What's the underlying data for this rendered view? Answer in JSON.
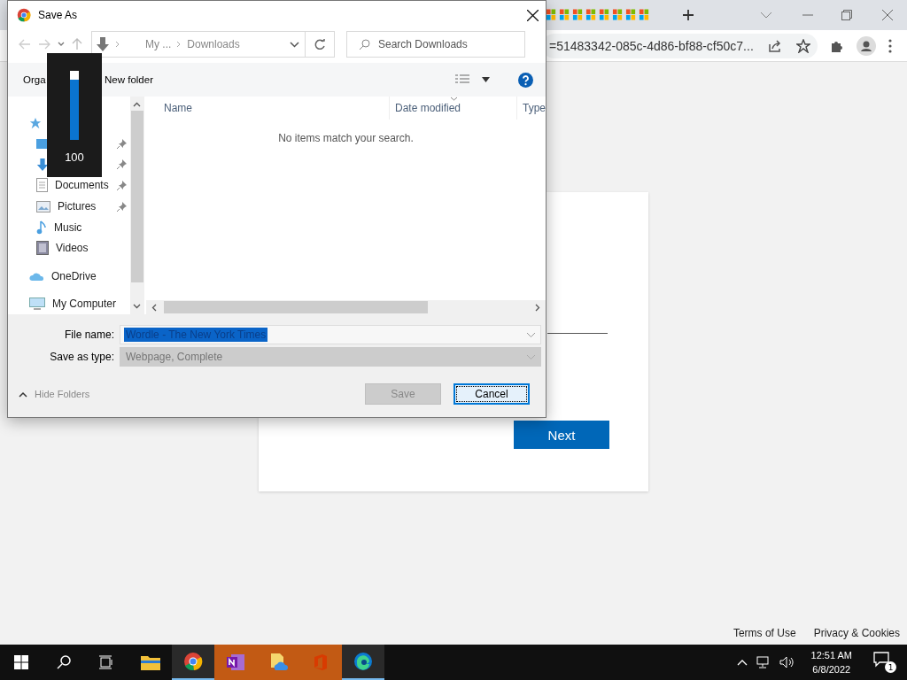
{
  "browser": {
    "address": "=51483342-085c-4d86-bf88-cf50c7..."
  },
  "page": {
    "next_button": "Next",
    "footer_links": [
      "Terms of Use",
      "Privacy & Cookies"
    ]
  },
  "dialog": {
    "title": "Save As",
    "breadcrumb": [
      "My ...",
      "Downloads"
    ],
    "search": {
      "placeholder": "Search Downloads"
    },
    "toolbar": {
      "organize": "Orga",
      "new_folder": "New folder"
    },
    "sidebar": {
      "items": [
        {
          "kind": "quick-access"
        },
        {
          "kind": "desktop",
          "pinned": true
        },
        {
          "kind": "downloads",
          "pinned": true
        },
        {
          "kind": "documents",
          "label": "Documents",
          "pinned": true
        },
        {
          "kind": "pictures",
          "label": "Pictures",
          "pinned": true
        },
        {
          "kind": "music",
          "label": "Music",
          "pinned": false
        },
        {
          "kind": "videos",
          "label": "Videos",
          "pinned": false
        },
        {
          "kind": "cloud",
          "label": "OneDrive",
          "pinned": false
        },
        {
          "kind": "computer",
          "label": "My Computer",
          "pinned": false
        }
      ]
    },
    "columns": [
      {
        "label": "Name",
        "sorted": false
      },
      {
        "label": "Date modified",
        "sorted": true
      },
      {
        "label": "Type",
        "sorted": false
      }
    ],
    "empty_message": "No items match your search.",
    "file_name": {
      "label": "File name:",
      "value": "Wordle - The New York Times",
      "selected": true
    },
    "save_type": {
      "label": "Save as type:",
      "value": "Webpage, Complete",
      "disabled": true
    },
    "hide_folders": "Hide Folders",
    "buttons": [
      {
        "label": "Save",
        "disabled": true,
        "focused": false
      },
      {
        "label": "Cancel",
        "disabled": false,
        "focused": true
      }
    ]
  },
  "volume": {
    "level": 1,
    "reading": "100"
  },
  "taskbar": {
    "apps": [
      {
        "kind": "explorer",
        "running": false,
        "flashing": false
      },
      {
        "kind": "chrome",
        "running": true,
        "flashing": false
      },
      {
        "kind": "onenote",
        "running": false,
        "flashing": true
      },
      {
        "kind": "files",
        "running": false,
        "flashing": true
      },
      {
        "kind": "office",
        "running": false,
        "flashing": true
      },
      {
        "kind": "edge",
        "running": true,
        "flashing": false
      }
    ],
    "time": "12:51 AM",
    "date": "6/8/2022",
    "notifications": "1"
  }
}
